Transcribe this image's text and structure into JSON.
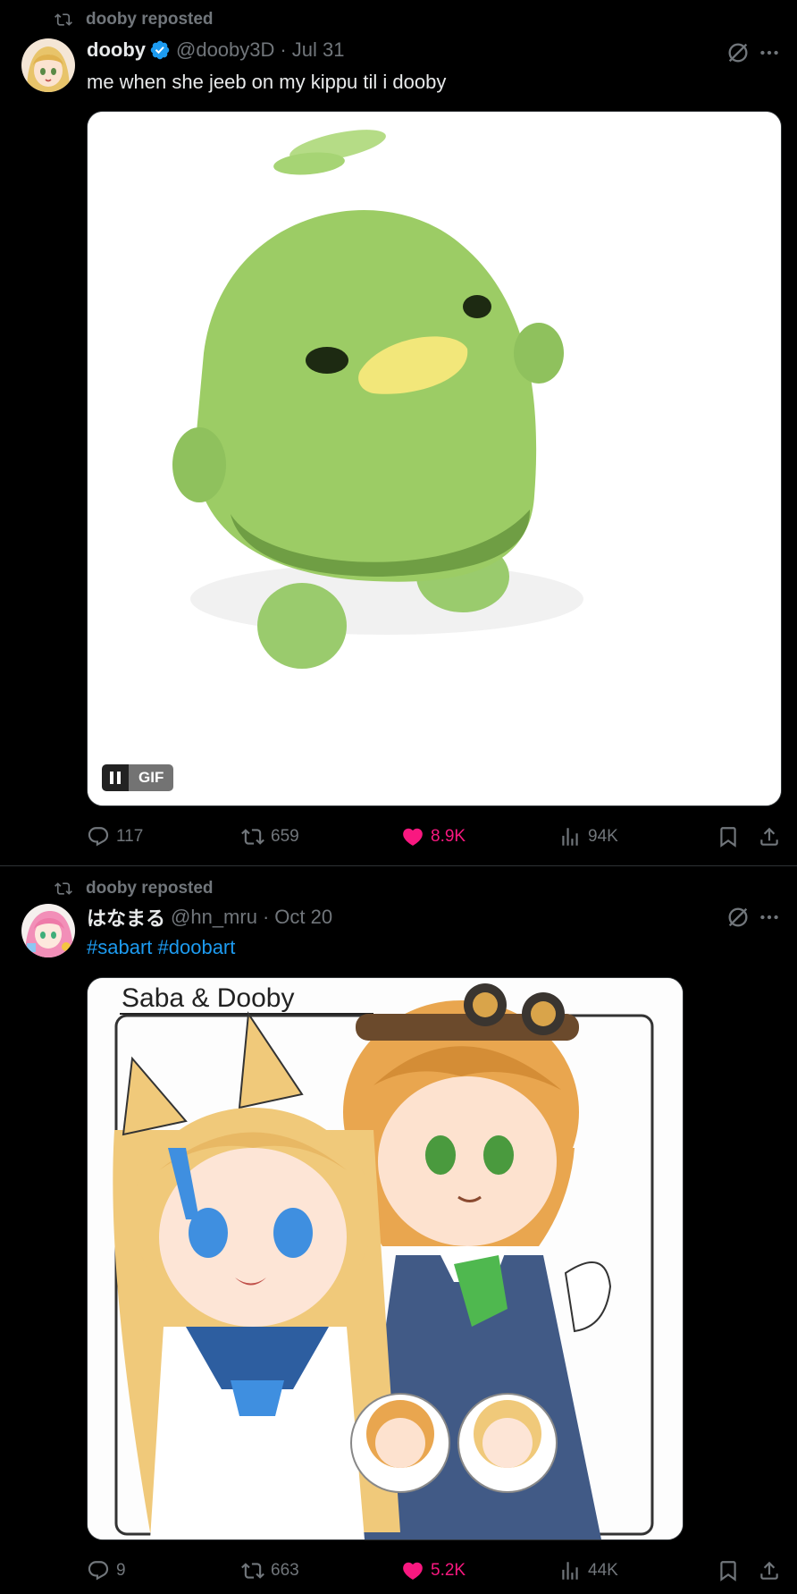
{
  "posts": [
    {
      "repost_label": "dooby reposted",
      "author": {
        "name": "dooby",
        "handle": "@dooby3D",
        "verified": true
      },
      "date": "Jul 31",
      "text": "me when she jeeb on my kippu til i dooby",
      "media": {
        "type": "gif",
        "badge": "GIF"
      },
      "stats": {
        "replies": "117",
        "reposts": "659",
        "likes": "8.9K",
        "views": "94K"
      },
      "liked": true
    },
    {
      "repost_label": "dooby reposted",
      "author": {
        "name": "はなまる",
        "handle": "@hn_mru",
        "verified": false
      },
      "date": "Oct 20",
      "hashtags": [
        "#sabart",
        "#doobart"
      ],
      "media": {
        "type": "image",
        "caption": "Saba & Dooby"
      },
      "stats": {
        "replies": "9",
        "reposts": "663",
        "likes": "5.2K",
        "views": "44K"
      },
      "liked": true
    }
  ],
  "colors": {
    "background": "#000000",
    "text": "#e7e9ea",
    "muted": "#71767b",
    "link": "#1d9bf0",
    "like": "#f91880",
    "divider": "#2f3336"
  },
  "icons": [
    "repost-icon",
    "verified-badge-icon",
    "grok-icon",
    "more-icon",
    "reply-icon",
    "heart-icon",
    "views-icon",
    "bookmark-icon",
    "share-icon",
    "pause-icon"
  ]
}
